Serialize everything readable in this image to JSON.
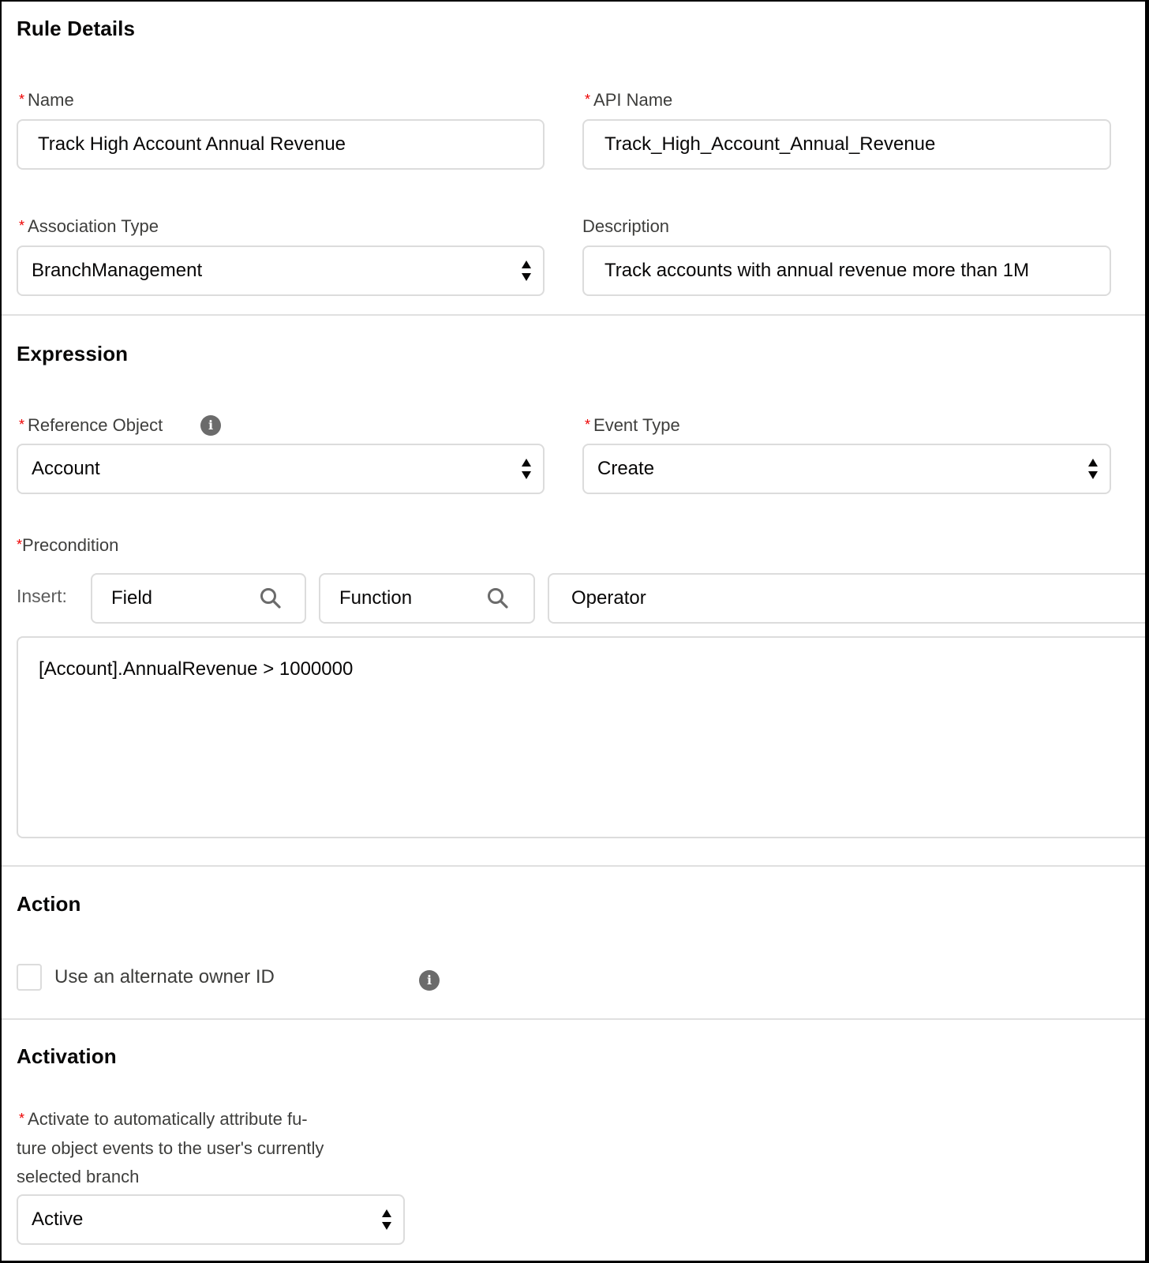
{
  "sections": {
    "rule_details": "Rule Details",
    "expression": "Expression",
    "action": "Action",
    "activation": "Activation"
  },
  "required_marker": "*",
  "rule_details": {
    "name": {
      "label": "Name",
      "value": "Track High Account Annual Revenue",
      "required": true
    },
    "api_name": {
      "label": "API Name",
      "value": "Track_High_Account_Annual_Revenue",
      "required": true
    },
    "association_type": {
      "label": "Association Type",
      "value": "BranchManagement",
      "required": true
    },
    "description": {
      "label": "Description",
      "value": "Track accounts with annual revenue more than 1M",
      "required": false
    }
  },
  "expression": {
    "reference_object": {
      "label": "Reference Object",
      "value": "Account",
      "required": true,
      "info_icon": "info-icon"
    },
    "event_type": {
      "label": "Event Type",
      "value": "Create",
      "required": true
    },
    "precondition": {
      "label": "Precondition",
      "insert_label": "Insert:",
      "field_placeholder": "Field",
      "function_placeholder": "Function",
      "operator_placeholder": "Operator",
      "formula": "[Account].AnnualRevenue > 1000000"
    }
  },
  "action": {
    "alternate_owner": {
      "label": "Use an alternate owner ID",
      "checked": false,
      "info_icon": "info-icon"
    }
  },
  "activation": {
    "label_line1": "Activate to automatically attribute fu-",
    "label_line2": "ture object events to the user's currently",
    "label_line3": "selected branch",
    "value": "Active",
    "required": true
  },
  "colors": {
    "required": "#ee0000",
    "border": "#dcdcdc",
    "divider": "#e0e0e0",
    "text": "#080707",
    "label": "#3e3e3c",
    "icon": "#6b6b6b"
  }
}
